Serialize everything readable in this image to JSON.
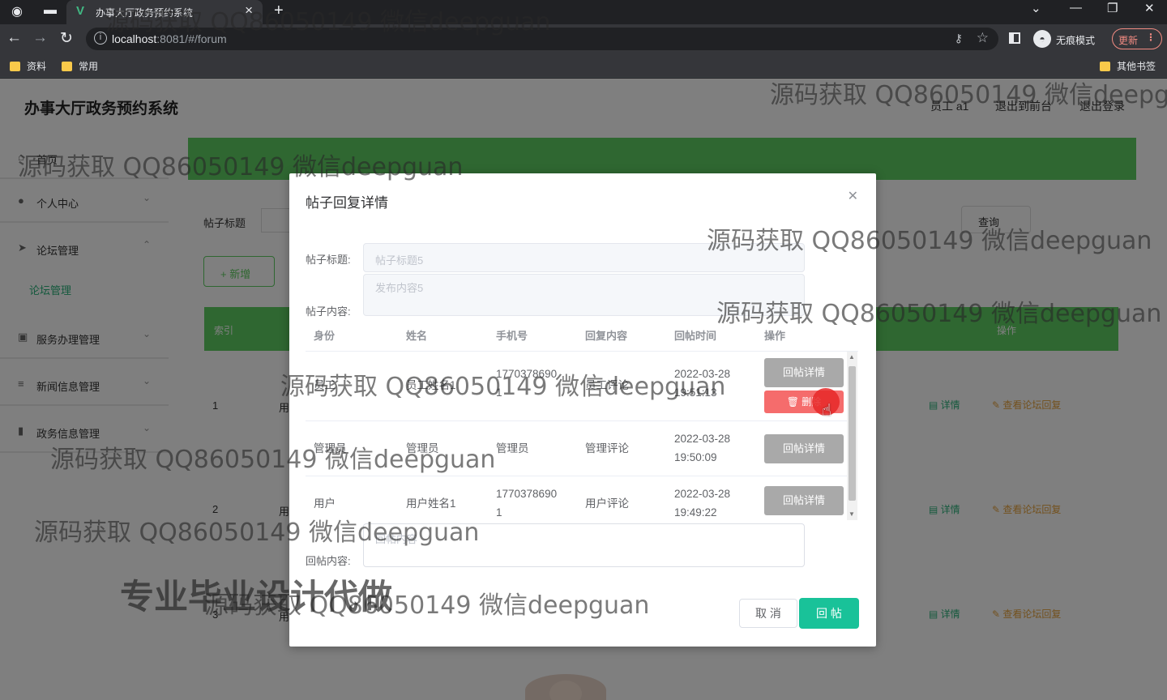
{
  "browser": {
    "tab_title": "办事大厅政务预约系统",
    "url_host": "localhost",
    "url_path": ":8081/#/forum",
    "incognito_label": "无痕模式",
    "update_label": "更新",
    "bookmarks": [
      "资料",
      "常用"
    ],
    "other_bookmarks": "其他书签"
  },
  "header": {
    "site_title": "办事大厅政务预约系统",
    "user_label": "员工 a1",
    "front_link": "退出到前台",
    "logout_link": "退出登录"
  },
  "sidebar": {
    "items": [
      {
        "label": "首页",
        "icon": "home-icon"
      },
      {
        "label": "个人中心",
        "icon": "user-icon"
      },
      {
        "label": "论坛管理",
        "icon": "forum-icon"
      },
      {
        "label": "服务办理管理",
        "icon": "chat-icon"
      },
      {
        "label": "新闻信息管理",
        "icon": "list-icon"
      },
      {
        "label": "政务信息管理",
        "icon": "bar-chart-icon"
      }
    ],
    "sub_item": "论坛管理"
  },
  "forum_page": {
    "filter_label": "帖子标题",
    "search_label": "查询",
    "add_label": "新增",
    "table_head": {
      "index": "索引",
      "action": "操作"
    },
    "rows": [
      {
        "no": "1",
        "name": "用"
      },
      {
        "no": "2",
        "name": "用"
      },
      {
        "no": "3",
        "name": "用"
      }
    ],
    "detail_label": "详情",
    "view_reply_label": "查看论坛回复"
  },
  "dialog": {
    "title": "帖子回复详情",
    "post_title_label": "帖子标题:",
    "post_title_value": "帖子标题5",
    "post_content_label": "帖子内容:",
    "post_content_value": "发布内容5",
    "columns": [
      "身份",
      "姓名",
      "手机号",
      "回复内容",
      "回帖时间",
      "操作"
    ],
    "replies": [
      {
        "role": "员工",
        "name": "员工姓名1",
        "phone": "17703786901",
        "content": "员工评论",
        "time": "2022-03-28 19:51:13"
      },
      {
        "role": "管理员",
        "name": "管理员",
        "phone": "管理员",
        "content": "管理评论",
        "time": "2022-03-28 19:50:09"
      },
      {
        "role": "用户",
        "name": "用户姓名1",
        "phone": "17703786901",
        "content": "用户评论",
        "time": "2022-03-28 19:49:22"
      }
    ],
    "reply_detail_label": "回帖详情",
    "delete_label": "删除",
    "reply_content_label": "回帖内容:",
    "reply_content_placeholder": "回帖内容",
    "cancel_label": "取 消",
    "submit_label": "回 帖"
  },
  "overlay_text": {
    "watermark": "源码获取 QQ86050149 微信deepguan",
    "banner": "专业毕业设计代做"
  }
}
